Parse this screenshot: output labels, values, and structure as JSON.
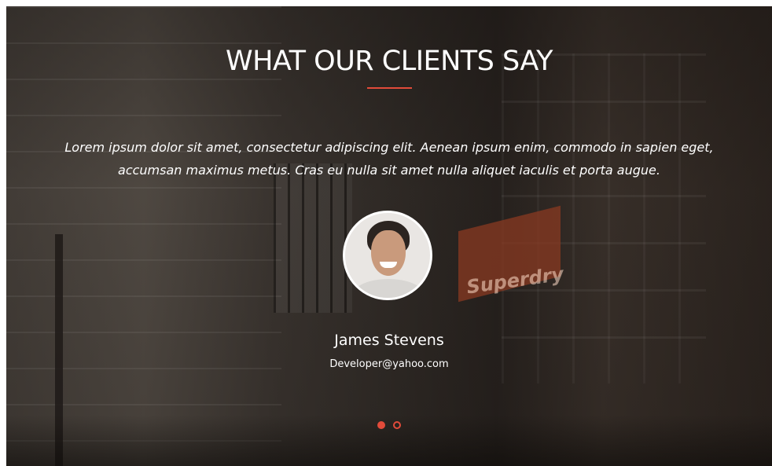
{
  "section": {
    "title": "WHAT OUR CLIENTS SAY",
    "accent_color": "#e24b3a"
  },
  "testimonial": {
    "quote_line1": "Lorem ipsum dolor sit amet, consectetur adipiscing elit. Aenean ipsum enim, commodo in sapien eget,",
    "quote_line2": "accumsan maximus metus. Cras eu nulla sit amet nulla aliquet iaculis et porta augue.",
    "name": "James Stevens",
    "email": "Developer@yahoo.com",
    "avatar_icon": "person-portrait"
  },
  "background": {
    "sign_text": "Superdry"
  },
  "carousel": {
    "dots": [
      {
        "state": "active"
      },
      {
        "state": "inactive"
      }
    ],
    "current": 1,
    "total": 2
  }
}
